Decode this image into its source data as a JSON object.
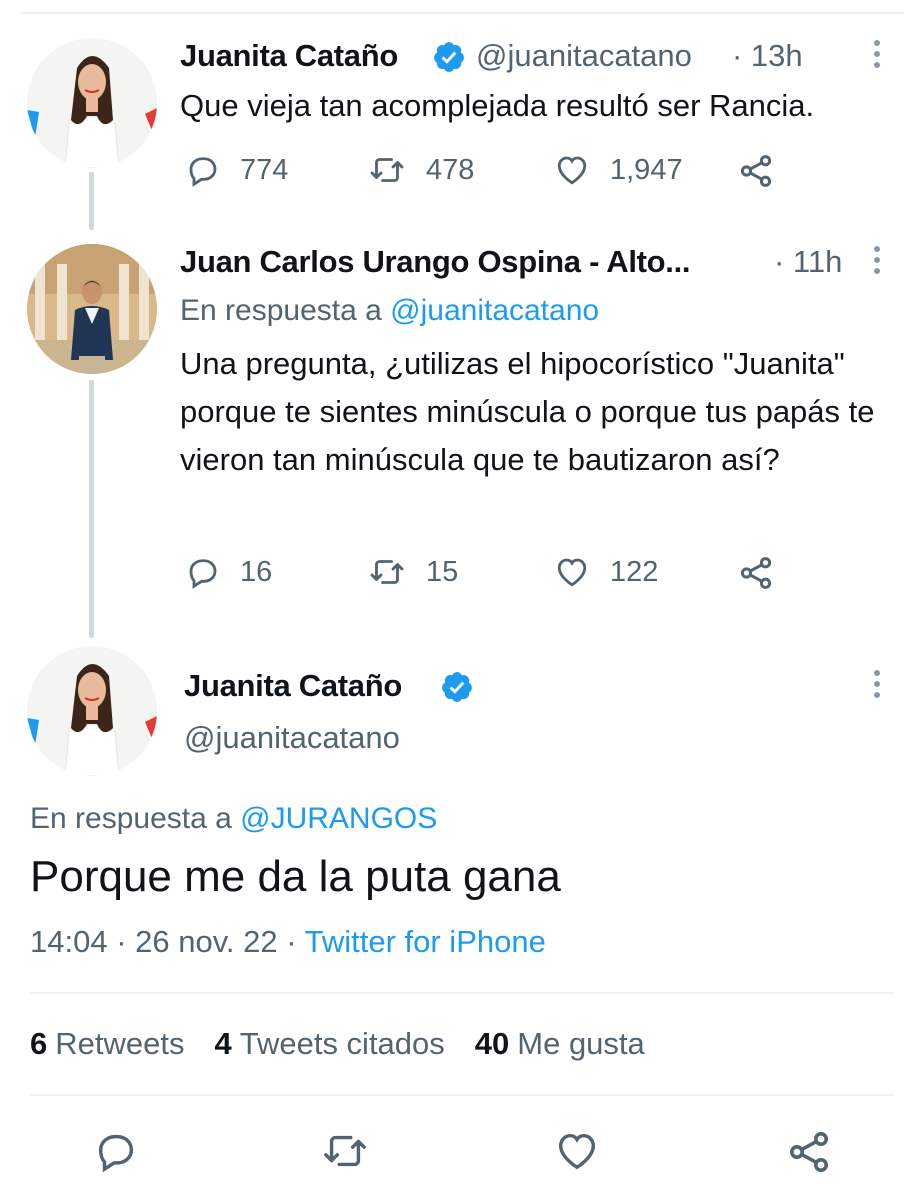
{
  "tweets": [
    {
      "name": "Juanita Cataño",
      "handle": "@juanitacatano",
      "time": "· 13h",
      "text": "Que vieja tan acomplejada resultó ser Rancia.",
      "replies": "774",
      "retweets": "478",
      "likes": "1,947"
    },
    {
      "name": "Juan Carlos Urango Ospina - Alto...",
      "time": "· 11h",
      "reply_prefix": "En respuesta a",
      "reply_mention": "@juanitacatano",
      "text": "Una pregunta, ¿utilizas el hipocorístico \"Juanita\" porque te sientes minúscula o porque tus papás te vieron tan minúscula que te bautizaron así?",
      "replies": "16",
      "retweets": "15",
      "likes": "122"
    }
  ],
  "main_tweet": {
    "name": "Juanita Cataño",
    "handle": "@juanitacatano",
    "reply_prefix": "En respuesta a",
    "reply_mention": "@JURANGOS",
    "text": "Porque me da la puta gana",
    "time": "14:04 · 26 nov. 22 ·",
    "source": "Twitter for iPhone",
    "stats": {
      "retweets_count": "6",
      "retweets_label": "Retweets",
      "quotes_count": "4",
      "quotes_label": "Tweets citados",
      "likes_count": "40",
      "likes_label": "Me gusta"
    }
  },
  "icons": [
    "reply-icon",
    "retweet-icon",
    "like-icon",
    "share-icon",
    "verified-badge-icon",
    "more-options-icon"
  ],
  "colors": {
    "accent": "#1d9bf0",
    "secondary_text": "#536471",
    "primary_text": "#0f1419",
    "thread_line": "#cfd9de"
  }
}
